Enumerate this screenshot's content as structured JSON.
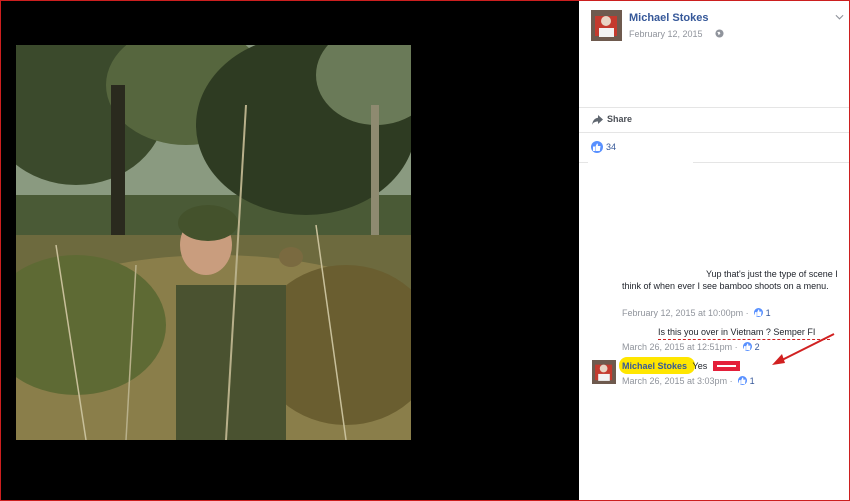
{
  "post": {
    "author": "Michael Stokes",
    "date": "February 12, 2015",
    "share_label": "Share",
    "likes": "34"
  },
  "comments": [
    {
      "text": "Yup that's just the type of scene I think of when ever I see bamboo shoots on a menu.",
      "timestamp": "February 12, 2015 at 10:00pm",
      "likes": "1"
    },
    {
      "text": "Is this you over in Vietnam ? Semper FI",
      "timestamp": "March 26, 2015 at 12:51pm",
      "likes": "2"
    },
    {
      "author": "Michael Stokes",
      "text": "Yes",
      "timestamp": "March 26, 2015 at 3:03pm",
      "likes": "1"
    }
  ],
  "colors": {
    "link": "#365899",
    "meta": "#90949c",
    "like_badge": "#5890ff",
    "highlight": "#ffe600",
    "annotation_red": "#d12020"
  },
  "icons": [
    "globe-icon",
    "chevron-down-icon",
    "share-icon",
    "like-icon"
  ]
}
